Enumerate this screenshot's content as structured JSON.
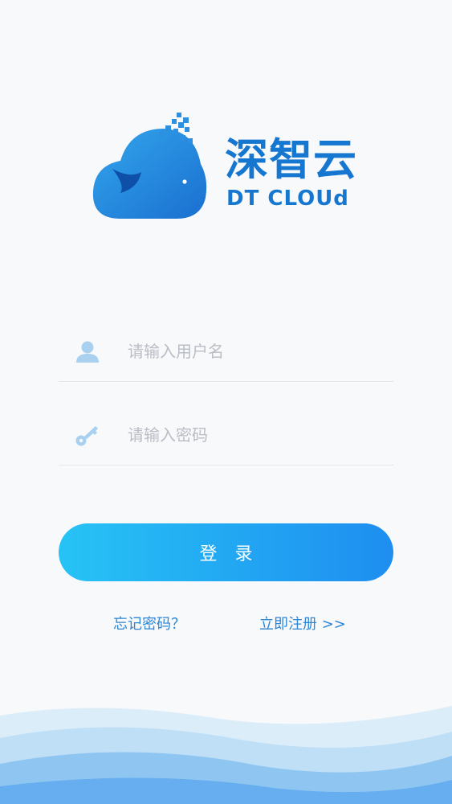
{
  "brand": {
    "name_cn": "深智云",
    "name_en": "DT CLOUd"
  },
  "form": {
    "username": {
      "placeholder": "请输入用户名",
      "value": "",
      "icon": "user-icon"
    },
    "password": {
      "placeholder": "请输入密码",
      "value": "",
      "icon": "key-icon"
    },
    "login_label": "登录"
  },
  "links": {
    "forgot": "忘记密码？",
    "register": "立即注册 >>"
  },
  "colors": {
    "brand": "#1577cf",
    "button_start": "#27c3f5",
    "button_end": "#1e8ef0",
    "link": "#2d86d6",
    "icon": "#a9d0ee"
  }
}
